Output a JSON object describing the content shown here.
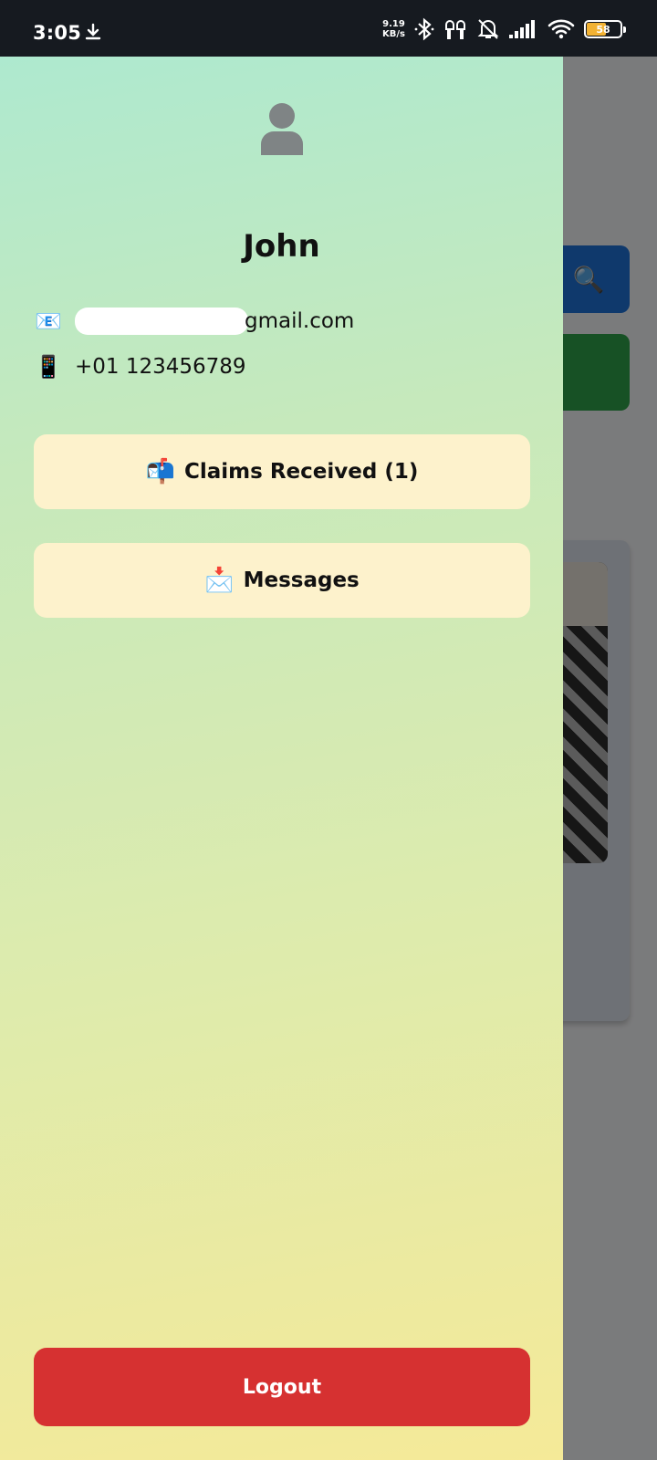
{
  "status_bar": {
    "time": "3:05",
    "net_speed_value": "9.19",
    "net_speed_unit": "KB/s",
    "battery_level": "58",
    "icons": [
      "download-icon",
      "bluetooth-icon",
      "earbuds-icon",
      "bell-muted-icon",
      "signal-icon",
      "wifi-icon",
      "battery-icon"
    ]
  },
  "drawer": {
    "user_name": "John",
    "email_emoji": "📧",
    "email_visible_suffix": "gmail.com",
    "phone_emoji": "📱",
    "phone": "+01 123456789",
    "claims_emoji": "📬",
    "claims_label": "Claims Received (1)",
    "messages_emoji": "📩",
    "messages_label": "Messages",
    "logout_label": "Logout"
  },
  "colors": {
    "drawer_gradient_top": "#aee9cf",
    "drawer_gradient_bottom": "#f5ea98",
    "menu_button_bg": "#fdf2cc",
    "logout_bg": "#d63131",
    "search_button": "#1e73d8",
    "green_button": "#2ea24a"
  },
  "background_app": {
    "search_icon": "🔍"
  }
}
